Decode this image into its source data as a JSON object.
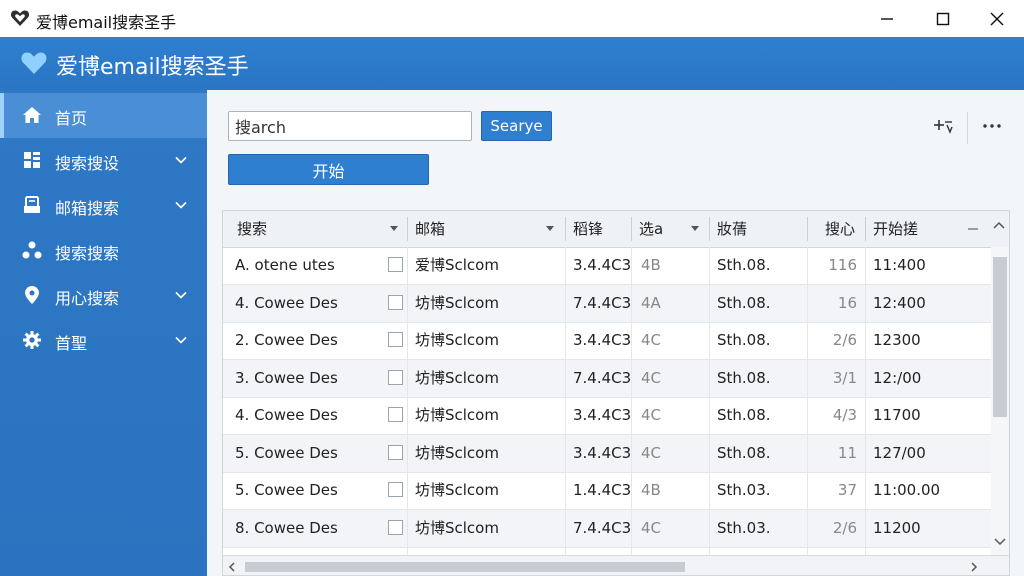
{
  "window": {
    "title": "爱博email搜索圣手",
    "icon": "heart-logo-icon"
  },
  "banner": {
    "title": "爱博email搜索圣手",
    "icon": "heart-icon"
  },
  "sidebar": {
    "items": [
      {
        "label": "首页",
        "icon": "home-icon",
        "active": true
      },
      {
        "label": "搜索搜设",
        "icon": "dashboard-icon"
      },
      {
        "label": "邮箱搜索",
        "icon": "mailbox-icon"
      },
      {
        "label": "搜索搜索",
        "icon": "network-icon"
      },
      {
        "label": "用心搜索",
        "icon": "location-icon"
      },
      {
        "label": "首聖",
        "icon": "gear-icon"
      }
    ]
  },
  "toolbar": {
    "search_value": "搜arch",
    "search_button": "Searye",
    "start_button": "开始"
  },
  "table": {
    "columns": [
      "搜索",
      "邮箱",
      "稻锋",
      "选a",
      "妝蒨",
      "搜心",
      "开始搓"
    ],
    "rows": [
      [
        "A. otene utes",
        "爱博Sclcom",
        "3.4.4C3",
        "4B",
        "Sth.08.",
        "116",
        "11:400"
      ],
      [
        "4. Cowee Des",
        "坊博Sclcom",
        "7.4.4C3",
        "4A",
        "Sth.08.",
        "16",
        "12:400"
      ],
      [
        "2. Cowee Des",
        "坊博Sclcom",
        "3.4.4C3",
        "4C",
        "Sth.08.",
        "2/6",
        "12300"
      ],
      [
        "3. Cowee Des",
        "坊博Sclcom",
        "7.4.4C3",
        "4C",
        "Sth.08.",
        "3/1",
        "12:/00"
      ],
      [
        "4. Cowee Des",
        "坊博Sclcom",
        "3.4.4C3",
        "4C",
        "Sth.08.",
        "4/3",
        "11700"
      ],
      [
        "5. Cowee Des",
        "坊博Sclcom",
        "3.4.4C3",
        "4C",
        "Sth.08.",
        "11",
        "127/00"
      ],
      [
        "5. Cowee Des",
        "坊博Sclcom",
        "1.4.4C3",
        "4B",
        "Sth.03.",
        "37",
        "11:00.00"
      ],
      [
        "8. Cowee Des",
        "坊博Sclcom",
        "7.4.4C3",
        "4C",
        "Sth.03.",
        "2/6",
        "11200"
      ]
    ]
  }
}
